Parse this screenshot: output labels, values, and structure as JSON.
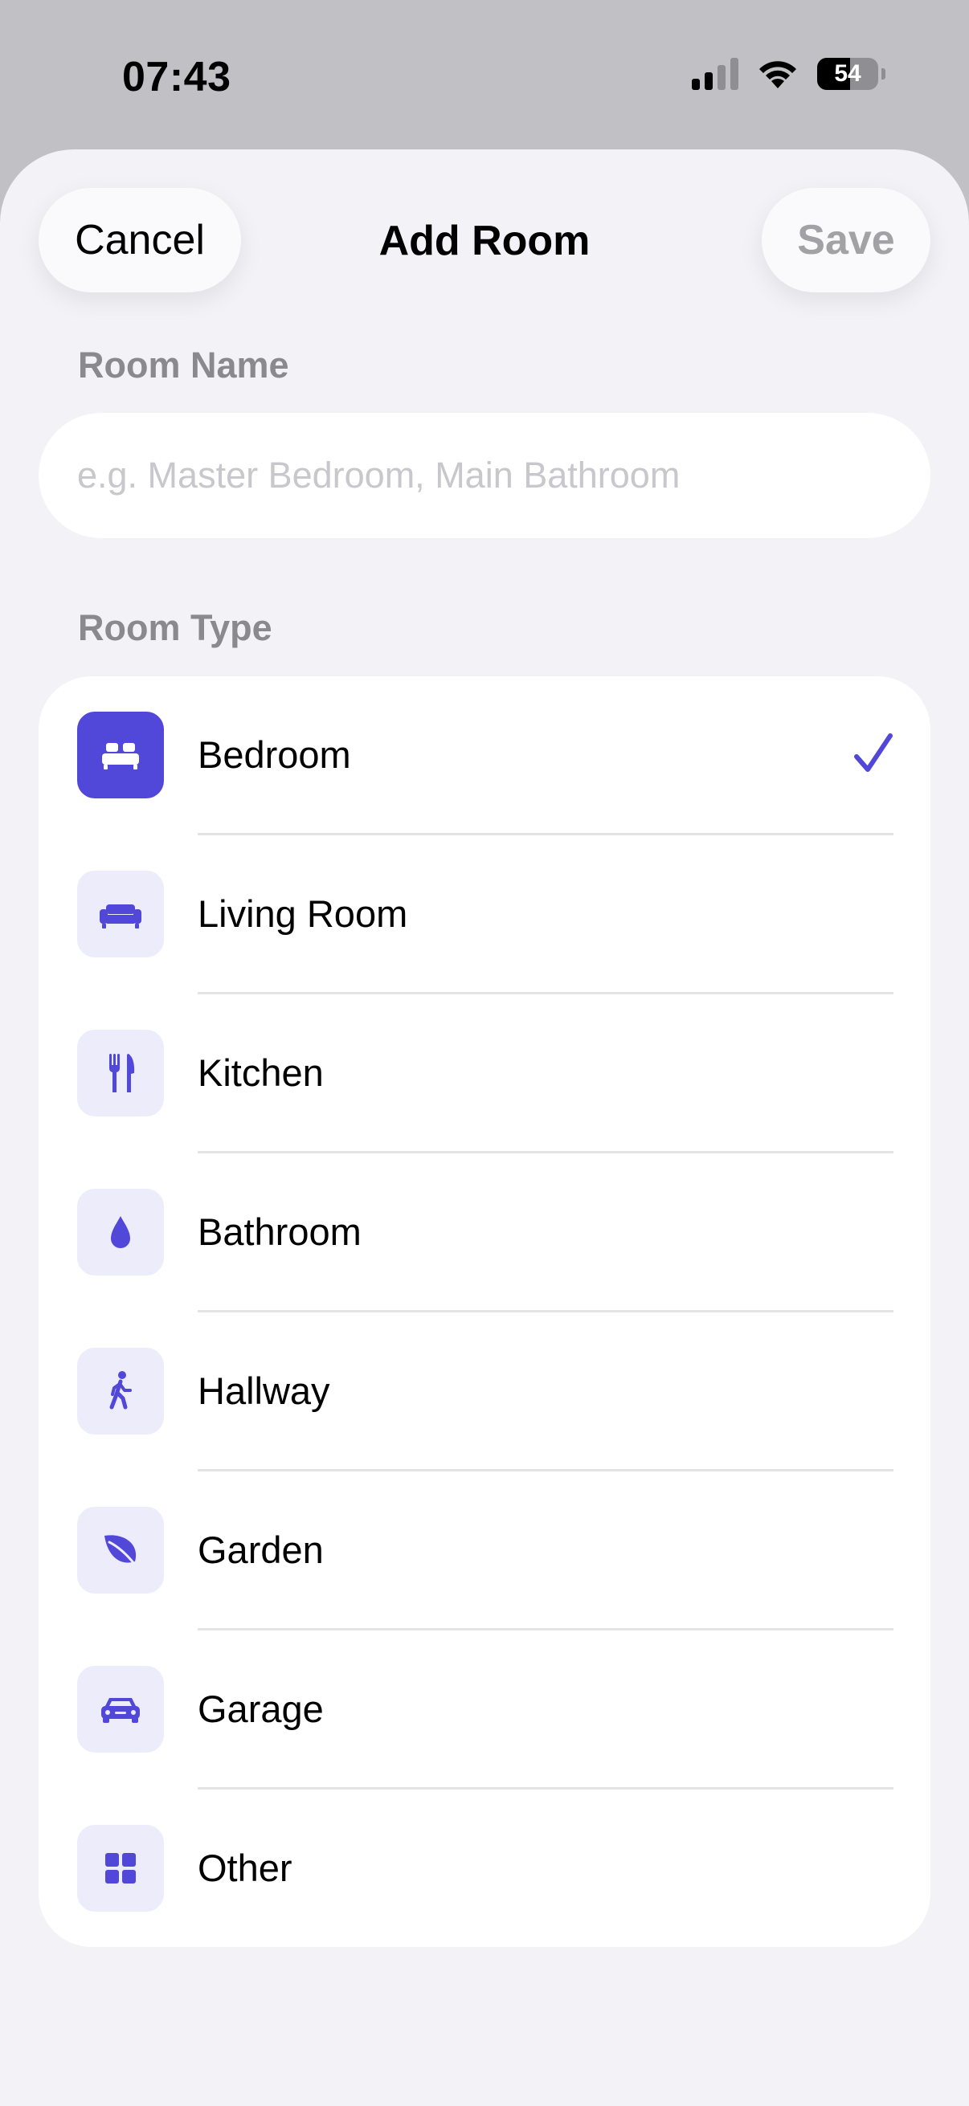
{
  "status_bar": {
    "time": "07:43",
    "battery_level": "54",
    "icons": [
      "cellular-signal-icon",
      "wifi-icon",
      "battery-icon"
    ]
  },
  "header": {
    "cancel_label": "Cancel",
    "title": "Add Room",
    "save_label": "Save"
  },
  "room_name": {
    "label": "Room Name",
    "value": "",
    "placeholder": "e.g. Master Bedroom, Main Bathroom"
  },
  "room_type": {
    "label": "Room Type",
    "selected": "Bedroom",
    "items": [
      {
        "label": "Bedroom",
        "icon": "bed-icon"
      },
      {
        "label": "Living Room",
        "icon": "sofa-icon"
      },
      {
        "label": "Kitchen",
        "icon": "fork-knife-icon"
      },
      {
        "label": "Bathroom",
        "icon": "drop-icon"
      },
      {
        "label": "Hallway",
        "icon": "walking-person-icon"
      },
      {
        "label": "Garden",
        "icon": "leaf-icon"
      },
      {
        "label": "Garage",
        "icon": "car-icon"
      },
      {
        "label": "Other",
        "icon": "grid-icon"
      }
    ]
  },
  "colors": {
    "accent": "#5147D9",
    "icon_tile": "#ECECFB",
    "disabled_text": "#A1A1A6",
    "background": "#F2F2F7"
  }
}
